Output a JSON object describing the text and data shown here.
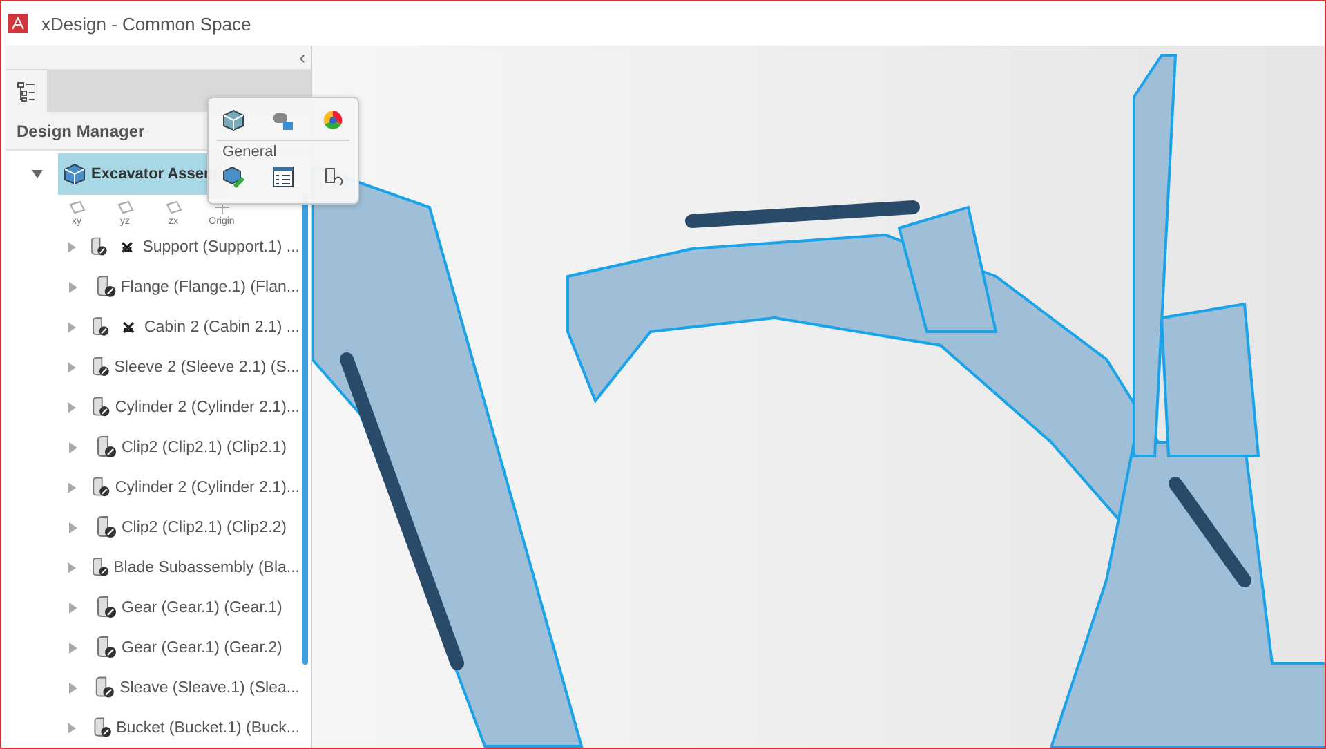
{
  "window": {
    "title": "xDesign - Common Space"
  },
  "panel": {
    "collapse": "‹",
    "tabs": [
      {
        "label": "Design Manager",
        "selected": true
      }
    ]
  },
  "popup": {
    "section": "General"
  },
  "tree": {
    "root": {
      "label": "Excavator Assem",
      "expanded": true
    },
    "origin": [
      {
        "label": "xy",
        "kind": "plane"
      },
      {
        "label": "yz",
        "kind": "plane"
      },
      {
        "label": "zx",
        "kind": "plane"
      },
      {
        "label": "Origin",
        "kind": "point"
      }
    ],
    "items": [
      {
        "label": "Support (Support.1) ...",
        "expanded": false,
        "fixed": true
      },
      {
        "label": "Flange (Flange.1) (Flan...",
        "expanded": false,
        "fixed": false
      },
      {
        "label": "Cabin 2 (Cabin 2.1) ...",
        "expanded": false,
        "fixed": true
      },
      {
        "label": "Sleeve 2 (Sleeve 2.1) (S...",
        "expanded": false,
        "fixed": false
      },
      {
        "label": "Cylinder 2 (Cylinder 2.1)...",
        "expanded": false,
        "fixed": false
      },
      {
        "label": "Clip2 (Clip2.1) (Clip2.1)",
        "expanded": false,
        "fixed": false
      },
      {
        "label": "Cylinder 2 (Cylinder 2.1)...",
        "expanded": false,
        "fixed": false
      },
      {
        "label": "Clip2 (Clip2.1) (Clip2.2)",
        "expanded": false,
        "fixed": false
      },
      {
        "label": "Blade Subassembly (Bla...",
        "expanded": false,
        "fixed": false
      },
      {
        "label": "Gear (Gear.1) (Gear.1)",
        "expanded": false,
        "fixed": false
      },
      {
        "label": "Gear (Gear.1) (Gear.2)",
        "expanded": false,
        "fixed": false
      },
      {
        "label": "Sleave (Sleave.1) (Slea...",
        "expanded": false,
        "fixed": false
      },
      {
        "label": "Bucket (Bucket.1) (Buck...",
        "expanded": false,
        "fixed": false
      }
    ]
  }
}
